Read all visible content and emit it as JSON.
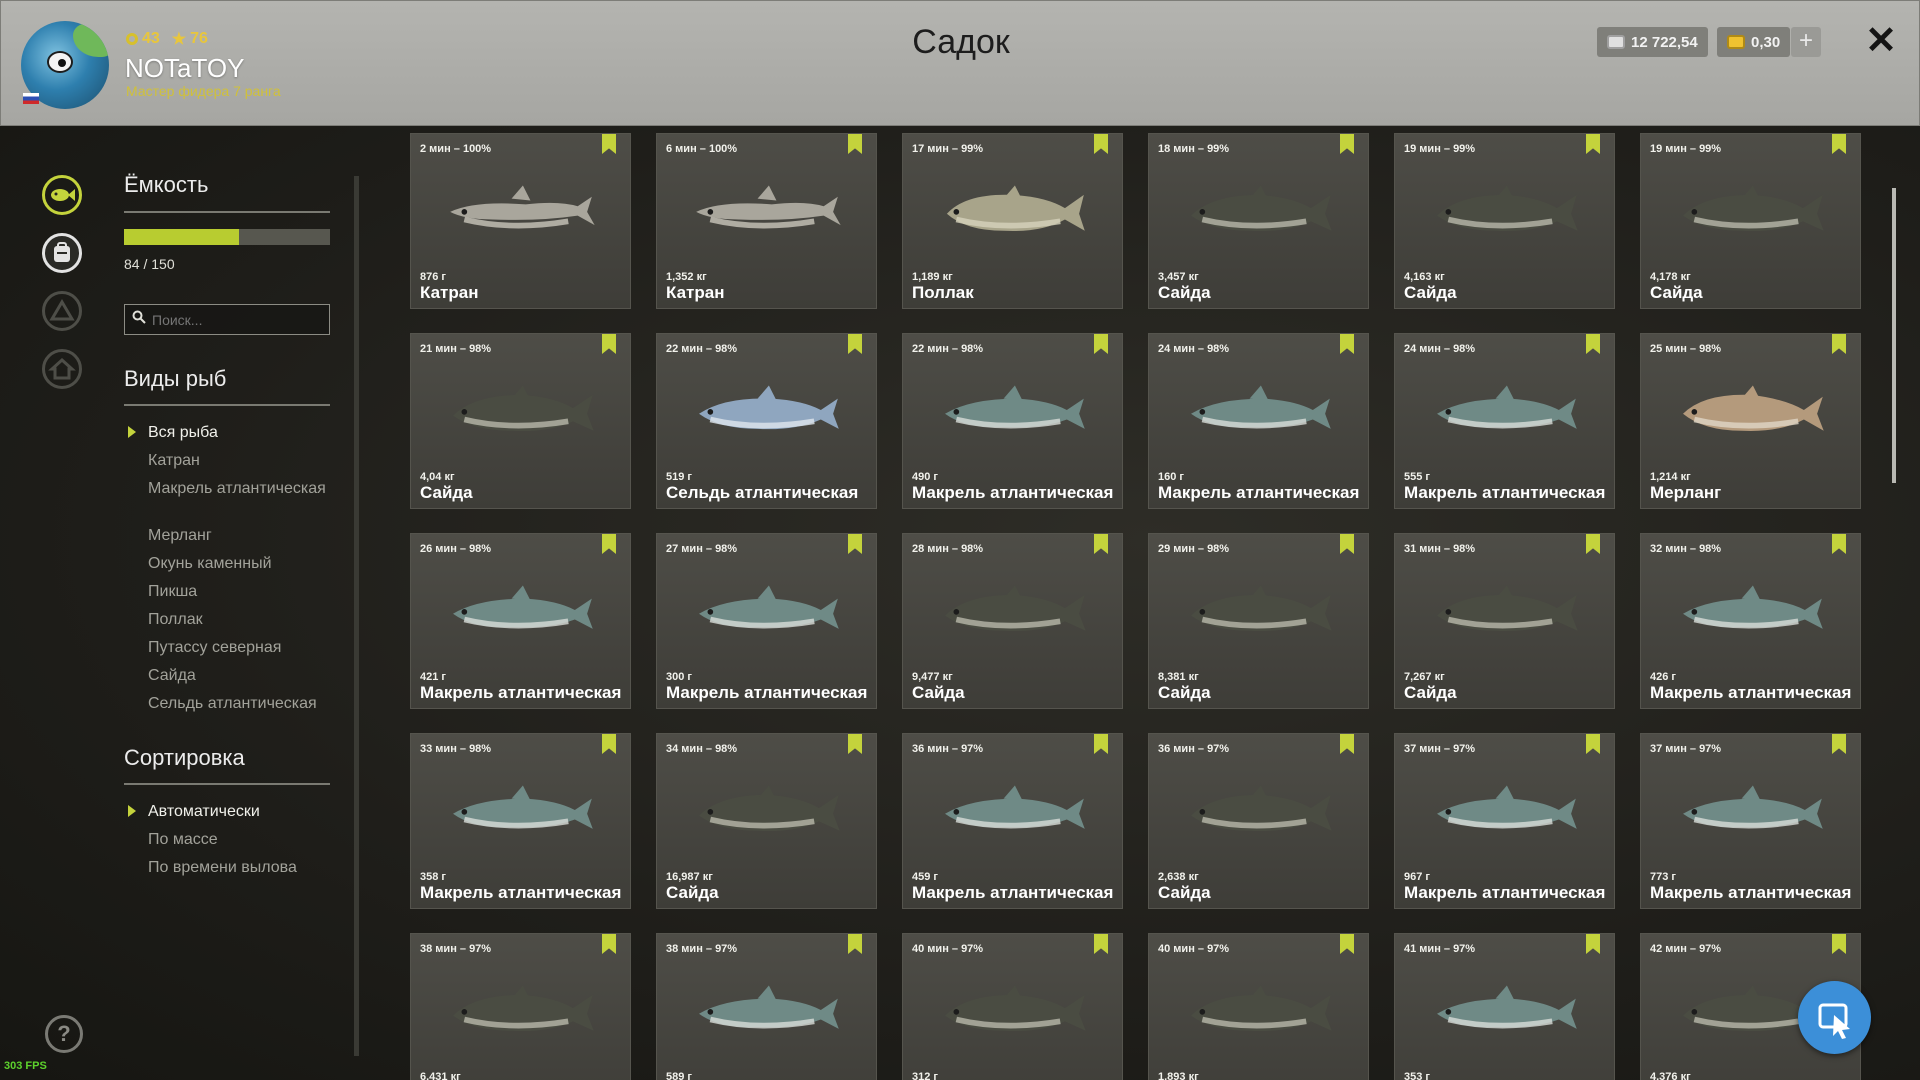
{
  "header": {
    "level": "43",
    "stars": "76",
    "username": "NOTaTOY",
    "rank": "Мастер фидера 7 ранга",
    "title": "Садок",
    "silver": "12 722,54",
    "gold": "0,30",
    "plus": "+",
    "close": "✕"
  },
  "panel": {
    "capacity_title": "Ёмкость",
    "capacity_text": "84 / 150",
    "capacity_fraction": 0.56,
    "search_placeholder": "Поиск...",
    "species_title": "Виды рыб",
    "species": [
      "Вся рыба",
      "Катран",
      "Макрель атлантическая",
      "Мерланг",
      "Окунь каменный",
      "Пикша",
      "Поллак",
      "Путассу северная",
      "Сайда",
      "Сельдь атлантическая"
    ],
    "sort_title": "Сортировка",
    "sort_options": [
      "Автоматически",
      "По массе",
      "По времени вылова"
    ]
  },
  "help": "?",
  "fps": "303 FPS",
  "cards": [
    {
      "time": "2 мин – 100%",
      "weight": "876 г",
      "name": "Катран",
      "kind": "shark"
    },
    {
      "time": "6 мин – 100%",
      "weight": "1,352 кг",
      "name": "Катран",
      "kind": "shark"
    },
    {
      "time": "17 мин – 99%",
      "weight": "1,189 кг",
      "name": "Поллак",
      "kind": "pollock"
    },
    {
      "time": "18 мин – 99%",
      "weight": "3,457 кг",
      "name": "Сайда",
      "kind": "saithe"
    },
    {
      "time": "19 мин – 99%",
      "weight": "4,163 кг",
      "name": "Сайда",
      "kind": "saithe"
    },
    {
      "time": "19 мин – 99%",
      "weight": "4,178 кг",
      "name": "Сайда",
      "kind": "saithe"
    },
    {
      "time": "21 мин – 98%",
      "weight": "4,04 кг",
      "name": "Сайда",
      "kind": "saithe"
    },
    {
      "time": "22 мин – 98%",
      "weight": "519 г",
      "name": "Сельдь атлантическая",
      "kind": "herring"
    },
    {
      "time": "22 мин – 98%",
      "weight": "490 г",
      "name": "Макрель атлантическая",
      "kind": "mackerel"
    },
    {
      "time": "24 мин – 98%",
      "weight": "160 г",
      "name": "Макрель атлантическая",
      "kind": "mackerel"
    },
    {
      "time": "24 мин – 98%",
      "weight": "555 г",
      "name": "Макрель атлантическая",
      "kind": "mackerel"
    },
    {
      "time": "25 мин – 98%",
      "weight": "1,214 кг",
      "name": "Мерланг",
      "kind": "whiting"
    },
    {
      "time": "26 мин – 98%",
      "weight": "421 г",
      "name": "Макрель атлантическая",
      "kind": "mackerel"
    },
    {
      "time": "27 мин – 98%",
      "weight": "300 г",
      "name": "Макрель атлантическая",
      "kind": "mackerel"
    },
    {
      "time": "28 мин – 98%",
      "weight": "9,477 кг",
      "name": "Сайда",
      "kind": "saithe"
    },
    {
      "time": "29 мин – 98%",
      "weight": "8,381 кг",
      "name": "Сайда",
      "kind": "saithe"
    },
    {
      "time": "31 мин – 98%",
      "weight": "7,267 кг",
      "name": "Сайда",
      "kind": "saithe"
    },
    {
      "time": "32 мин – 98%",
      "weight": "426 г",
      "name": "Макрель атлантическая",
      "kind": "mackerel"
    },
    {
      "time": "33 мин – 98%",
      "weight": "358 г",
      "name": "Макрель атлантическая",
      "kind": "mackerel"
    },
    {
      "time": "34 мин – 98%",
      "weight": "16,987 кг",
      "name": "Сайда",
      "kind": "saithe"
    },
    {
      "time": "36 мин – 97%",
      "weight": "459 г",
      "name": "Макрель атлантическая",
      "kind": "mackerel"
    },
    {
      "time": "36 мин – 97%",
      "weight": "2,638 кг",
      "name": "Сайда",
      "kind": "saithe"
    },
    {
      "time": "37 мин – 97%",
      "weight": "967 г",
      "name": "Макрель атлантическая",
      "kind": "mackerel"
    },
    {
      "time": "37 мин – 97%",
      "weight": "773 г",
      "name": "Макрель атлантическая",
      "kind": "mackerel"
    },
    {
      "time": "38 мин – 97%",
      "weight": "6,431 кг",
      "name": "",
      "kind": "saithe"
    },
    {
      "time": "38 мин – 97%",
      "weight": "589 г",
      "name": "",
      "kind": "mackerel"
    },
    {
      "time": "40 мин – 97%",
      "weight": "312 г",
      "name": "",
      "kind": "saithe"
    },
    {
      "time": "40 мин – 97%",
      "weight": "1,893 кг",
      "name": "",
      "kind": "saithe"
    },
    {
      "time": "41 мин – 97%",
      "weight": "353 г",
      "name": "",
      "kind": "mackerel"
    },
    {
      "time": "42 мин – 97%",
      "weight": "4,376 кг",
      "name": "",
      "kind": "saithe"
    }
  ],
  "colors": {
    "accent": "#c4d33c",
    "cursor_button": "#3c8fd8"
  }
}
